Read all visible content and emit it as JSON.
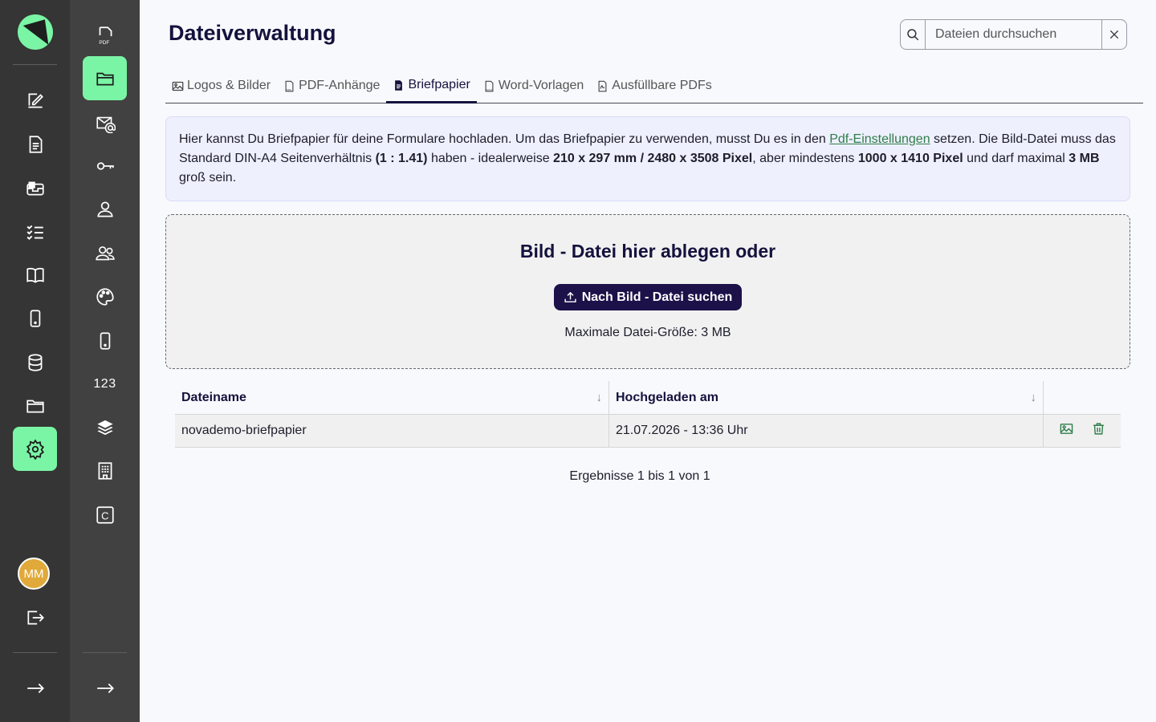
{
  "app": {
    "title": "Dateiverwaltung",
    "avatar_initials": "MM",
    "accent": "#7af5a5",
    "brand_dark": "#1c1148"
  },
  "rail1": {
    "items": [
      {
        "icon": "signature-edit-icon"
      },
      {
        "icon": "form-document-icon"
      },
      {
        "icon": "inbox-icon"
      },
      {
        "icon": "checklist-icon"
      },
      {
        "icon": "book-icon"
      },
      {
        "icon": "smartphone-icon"
      },
      {
        "icon": "database-icon"
      },
      {
        "icon": "folder-icon"
      },
      {
        "icon": "settings-gear-icon",
        "active": true
      }
    ]
  },
  "rail2": {
    "items": [
      {
        "icon": "pdf-file-icon"
      },
      {
        "icon": "folder-open-icon",
        "active": true
      },
      {
        "icon": "mail-at-icon"
      },
      {
        "icon": "key-icon"
      },
      {
        "icon": "user-icon"
      },
      {
        "icon": "users-group-icon"
      },
      {
        "icon": "palette-icon"
      },
      {
        "icon": "mobile-device-icon"
      },
      {
        "icon": "number-icon",
        "label": "123"
      },
      {
        "icon": "layers-icon"
      },
      {
        "icon": "building-icon"
      },
      {
        "icon": "c-box-icon",
        "label": "C"
      }
    ]
  },
  "search": {
    "placeholder": "Dateien durchsuchen",
    "value": ""
  },
  "tabs": [
    {
      "label": "Logos & Bilder",
      "icon": "image-icon"
    },
    {
      "label": "PDF-Anhänge",
      "icon": "pdf-file-icon"
    },
    {
      "label": "Briefpapier",
      "icon": "document-icon",
      "active": true
    },
    {
      "label": "Word-Vorlagen",
      "icon": "docx-file-icon"
    },
    {
      "label": "Ausfüllbare PDFs",
      "icon": "fillable-pdf-icon"
    }
  ],
  "info": {
    "text1": "Hier kannst Du Briefpapier für deine Formulare hochladen. Um das Briefpapier zu verwenden, musst Du es in den ",
    "link": "Pdf-Einstellungen",
    "text2": " setzen. Die Bild-Datei muss das Standard DIN-A4 Seitenverhältnis ",
    "ratio": "(1 : 1.41)",
    "text3": " haben - idealerweise ",
    "ideal": "210 x 297 mm / 2480 x 3508 Pixel",
    "text4": ", aber mindestens ",
    "minimum": "1000 x 1410 Pixel",
    "text5": " und darf maximal ",
    "maxsize": "3 MB",
    "text6": " groß sein."
  },
  "dropzone": {
    "title": "Bild - Datei hier ablegen oder",
    "button_label": "Nach Bild - Datei suchen",
    "max_size_text": "Maximale Datei-Größe: 3 MB"
  },
  "table": {
    "columns": [
      "Dateiname",
      "Hochgeladen am"
    ],
    "rows": [
      {
        "name": "novademo-briefpapier",
        "uploaded": "21.07.2026 - 13:36 Uhr"
      }
    ],
    "results_text": "Ergebnisse 1 bis 1 von 1"
  }
}
